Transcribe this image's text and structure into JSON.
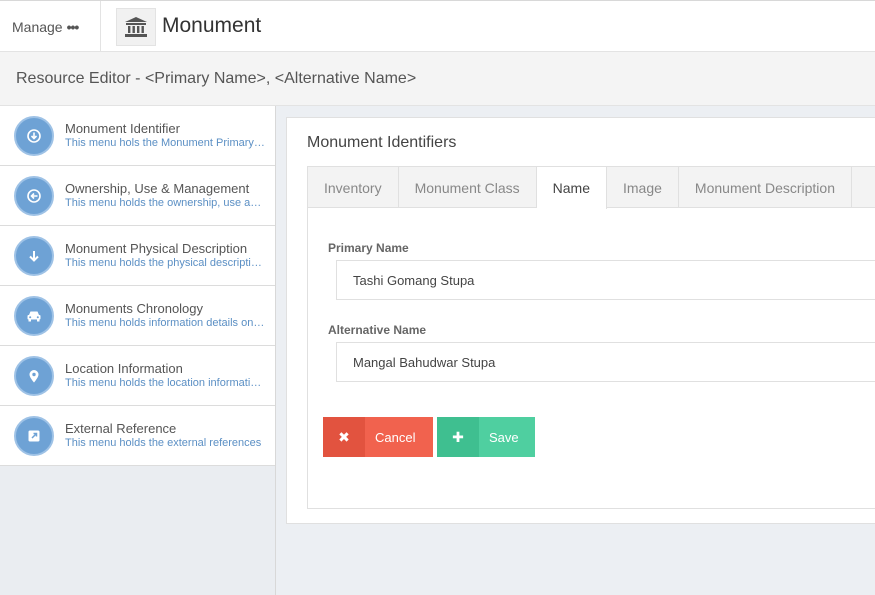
{
  "topbar": {
    "manage_label": "Manage",
    "manage_dots": "•••",
    "page_title": "Monument"
  },
  "editor": {
    "header_title": "Resource Editor - <Primary Name>, <Alternative Name>"
  },
  "sidebar": {
    "items": [
      {
        "label": "Monument Identifier",
        "desc": "This menu hols the Monument Primary Name",
        "icon": "arrow-down-circle-icon"
      },
      {
        "label": "Ownership, Use & Management",
        "desc": "This menu holds the ownership, use and management",
        "icon": "arrow-left-circle-icon"
      },
      {
        "label": "Monument Physical Description",
        "desc": "This menu holds the physical description details",
        "icon": "arrow-down-icon"
      },
      {
        "label": "Monuments Chronology",
        "desc": "This menu holds information details on chronology",
        "icon": "car-icon"
      },
      {
        "label": "Location Information",
        "desc": "This menu holds the location information details",
        "icon": "map-marker-icon"
      },
      {
        "label": "External Reference",
        "desc": "This menu holds the external references",
        "icon": "external-link-icon"
      }
    ]
  },
  "panel": {
    "title": "Monument Identifiers",
    "tabs": [
      {
        "label": "Inventory",
        "active": false
      },
      {
        "label": "Monument Class",
        "active": false
      },
      {
        "label": "Name",
        "active": true
      },
      {
        "label": "Image",
        "active": false
      },
      {
        "label": "Monument Description",
        "active": false
      }
    ],
    "fields": {
      "primary_label": "Primary Name",
      "primary_value": "Tashi Gomang Stupa",
      "alternative_label": "Alternative Name",
      "alternative_value": "Mangal Bahudwar Stupa"
    },
    "buttons": {
      "cancel_label": "Cancel",
      "cancel_icon": "✖",
      "save_label": "Save",
      "save_icon": "✚"
    }
  },
  "colors": {
    "accent_blue": "#6ea2d5",
    "cancel_red": "#f1624e",
    "save_green": "#4fcfa0"
  }
}
